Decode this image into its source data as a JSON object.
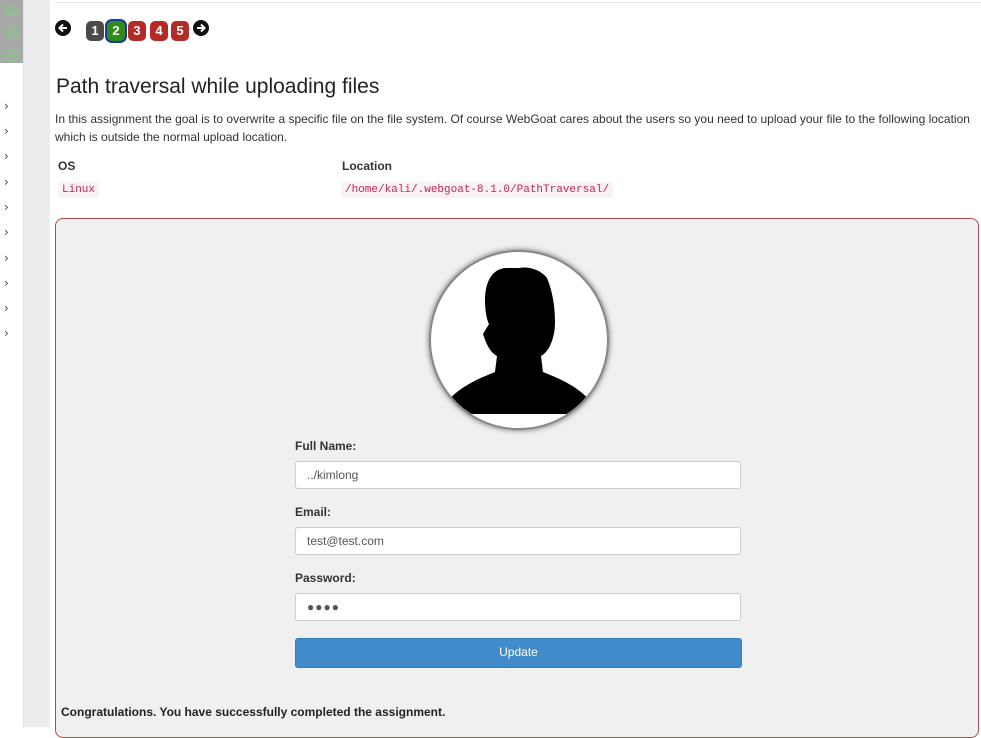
{
  "sidebar": {
    "completed_icons": [
      "check-square-icon",
      "check-square-icon",
      "check-square-icon"
    ],
    "expand_arrows": [
      "›",
      "›",
      "›",
      "›",
      "›",
      "›",
      "›",
      "›",
      "›",
      "›"
    ],
    "colors": {
      "top": "#a8a8a8",
      "check": "#7fd07f"
    }
  },
  "pagination": {
    "prev_icon": "arrow-circle-left-icon",
    "next_icon": "arrow-circle-right-icon",
    "pages": [
      {
        "label": "1",
        "state": "done"
      },
      {
        "label": "2",
        "state": "current"
      },
      {
        "label": "3",
        "state": "todo"
      },
      {
        "label": "4",
        "state": "todo"
      },
      {
        "label": "5",
        "state": "todo"
      }
    ]
  },
  "lesson": {
    "title": "Path traversal while uploading files",
    "description": "In this assignment the goal is to overwrite a specific file on the file system. Of course WebGoat cares about the users so you need to upload your file to the following location which is outside the normal upload location.",
    "table": {
      "headers": [
        "OS",
        "Location"
      ],
      "rows": [
        [
          "Linux",
          "/home/kali/.webgoat-8.1.0/PathTraversal/"
        ]
      ]
    }
  },
  "form": {
    "avatar_icon": "user-silhouette-icon",
    "fullname_label": "Full Name:",
    "fullname_value": "../kimlong",
    "email_label": "Email:",
    "email_value": "test@test.com",
    "password_label": "Password:",
    "password_value": "●●●●",
    "update_label": "Update"
  },
  "feedback": "Congratulations. You have successfully completed the assignment."
}
